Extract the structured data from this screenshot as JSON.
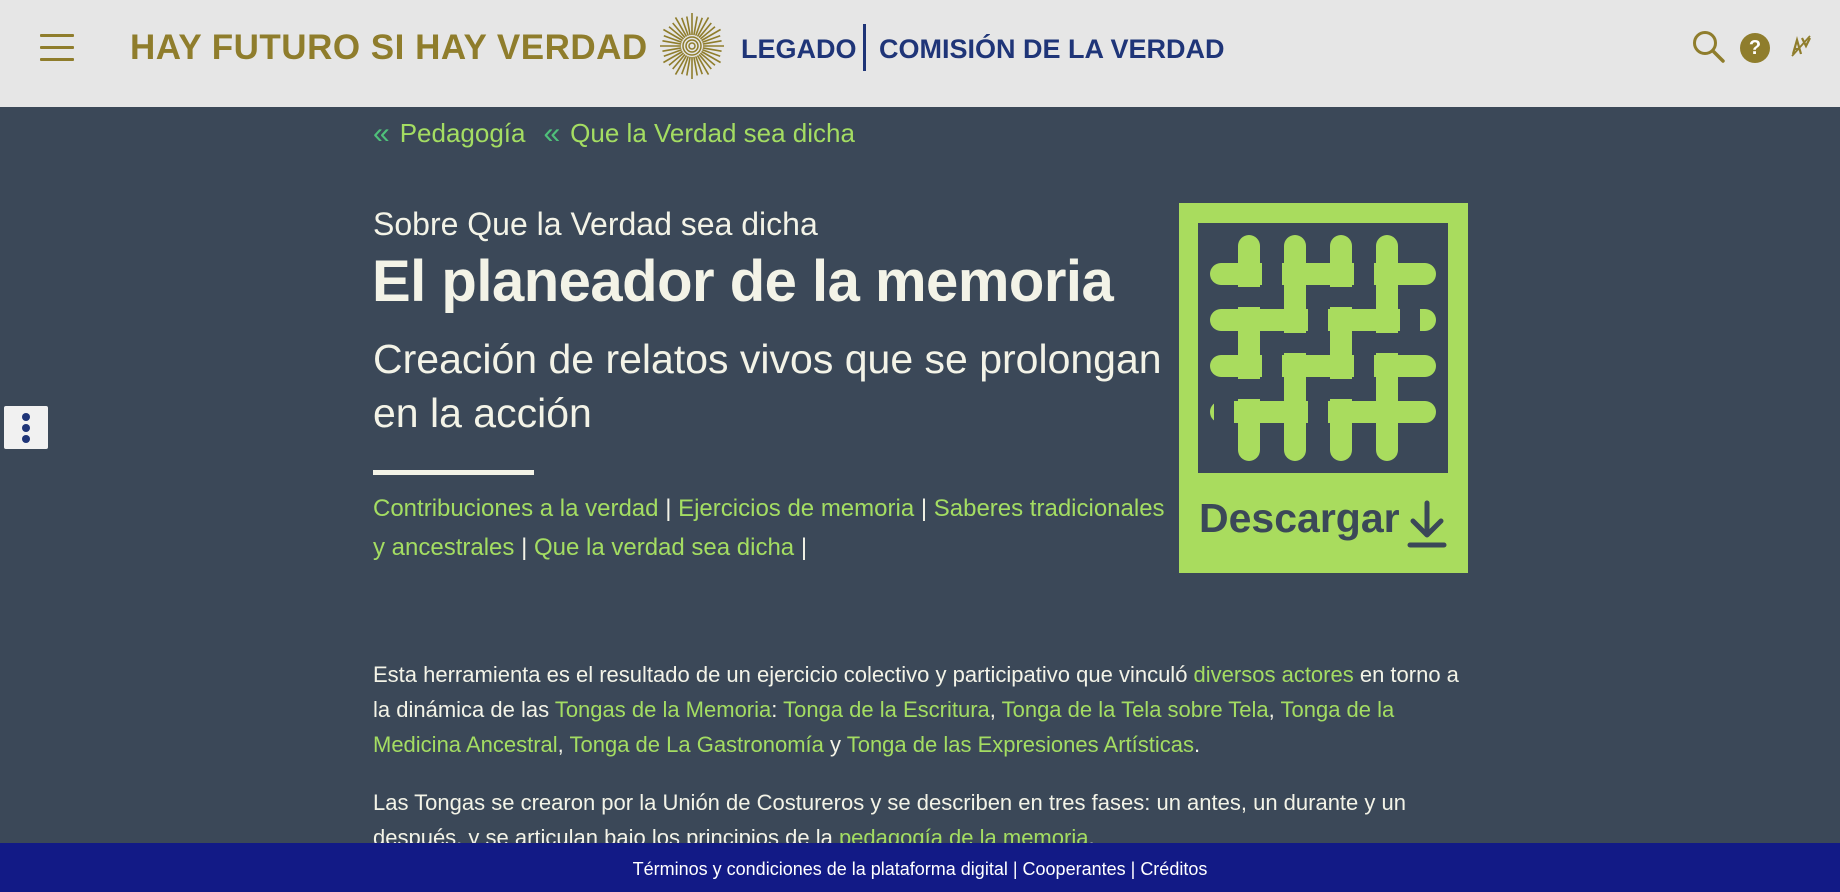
{
  "header": {
    "slogan": "HAY FUTURO SI HAY VERDAD",
    "legado": "LEGADO",
    "comision": "COMISIÓN DE LA VERDAD",
    "help_label": "?",
    "icons": [
      "menu-icon",
      "sun-logo-icon",
      "search-icon",
      "help-icon",
      "accessibility-icon"
    ]
  },
  "breadcrumb": [
    {
      "label": "Pedagogía"
    },
    {
      "label": "Que la Verdad sea dicha"
    }
  ],
  "hero": {
    "pre_title": "Sobre Que la Verdad sea dicha",
    "title": "El planeador de la memoria",
    "subtitle": "Creación de relatos vivos que se prolongan en la acción"
  },
  "tags": {
    "items": [
      "Contribuciones a la verdad",
      "Ejercicios de memoria",
      "Saberes tradicionales y ancestrales",
      "Que la verdad sea dicha"
    ],
    "separator": "|"
  },
  "download": {
    "label": "Descargar",
    "icon": "download-icon"
  },
  "paragraph1": {
    "t1": "Esta herramienta es el resultado de un ejercicio colectivo y participativo que vinculó ",
    "l1": "diversos actores",
    "t2": " en torno a la dinámica de las ",
    "l2": "Tongas de la Memoria",
    "t3": ": ",
    "l3": "Tonga de la Escritura",
    "t4": ", ",
    "l4": "Tonga de la Tela sobre Tela",
    "t5": ", ",
    "l5": "Tonga de la Medicina Ancestral",
    "t6": ", ",
    "l6": "Tonga de La Gastronomía",
    "t7": " y ",
    "l7": "Tonga de las Expresiones Artísticas",
    "t8": "."
  },
  "paragraph2": {
    "t1": "Las Tongas se crearon por la Unión de Costureros y se describen en tres fases: un antes, un durante y un después, y se articulan bajo los principios de la ",
    "l1": "pedagogía de la memoria",
    "t2": "."
  },
  "footer": {
    "terms": "Términos y condiciones de la plataforma digital",
    "cooperantes": "Cooperantes",
    "creditos": "Créditos",
    "separator": "|"
  },
  "colors": {
    "header_bg": "#e6e6e6",
    "page_bg": "#3b4858",
    "gold": "#8f7d2c",
    "navy": "#1f3578",
    "link_green": "#a4dd62",
    "card_green": "#a9dc5e",
    "footer_bg": "#121a86"
  }
}
